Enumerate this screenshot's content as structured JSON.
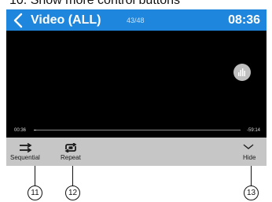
{
  "caption": "10. Show more control buttons",
  "header": {
    "title": "Video (ALL)",
    "track_counter": "43/48",
    "clock": "08:36"
  },
  "player": {
    "elapsed": "00:36",
    "remaining": "-59:14",
    "progress_fraction": 0.006
  },
  "controls": [
    {
      "label": "Sequential",
      "icon": "sequential-icon"
    },
    {
      "label": "Repeat",
      "icon": "repeat-all-icon"
    },
    {
      "label": "Hide",
      "icon": "chevron-down-icon"
    }
  ],
  "callouts": [
    "11",
    "12",
    "13"
  ],
  "colors": {
    "header_bg": "#1e86dc",
    "video_bg": "#000000",
    "control_bar_bg": "#c6c6c6"
  }
}
